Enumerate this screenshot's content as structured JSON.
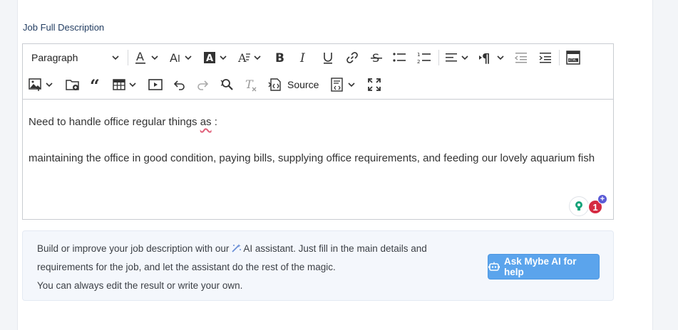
{
  "field": {
    "label": "Job Full Description"
  },
  "toolbar": {
    "paragraph_label": "Paragraph",
    "source_label": "Source"
  },
  "editor": {
    "line1_before": "Need to handle office regular things ",
    "line1_misspelled": "as",
    "line1_after": " :",
    "line2": "maintaining the office in good condition, paying bills, supplying office requirements, and feeding our lovely aquarium fish"
  },
  "grammarly": {
    "count": "1",
    "plus": "+"
  },
  "ai": {
    "line1_before": "Build or improve your job description with our",
    "line1_after": "AI assistant. Just fill in the main details and",
    "line2": "requirements for the job, and let the assistant do the rest of the magic.",
    "line3": "You can always edit the result or write your own.",
    "button_label": "Ask Mybe AI for help"
  },
  "colors": {
    "label": "#1f3a5f",
    "button": "#5ba4ec",
    "spell_underline": "#e0607a",
    "grammarly_red": "#d52a42",
    "grammarly_green": "#15a37a"
  }
}
